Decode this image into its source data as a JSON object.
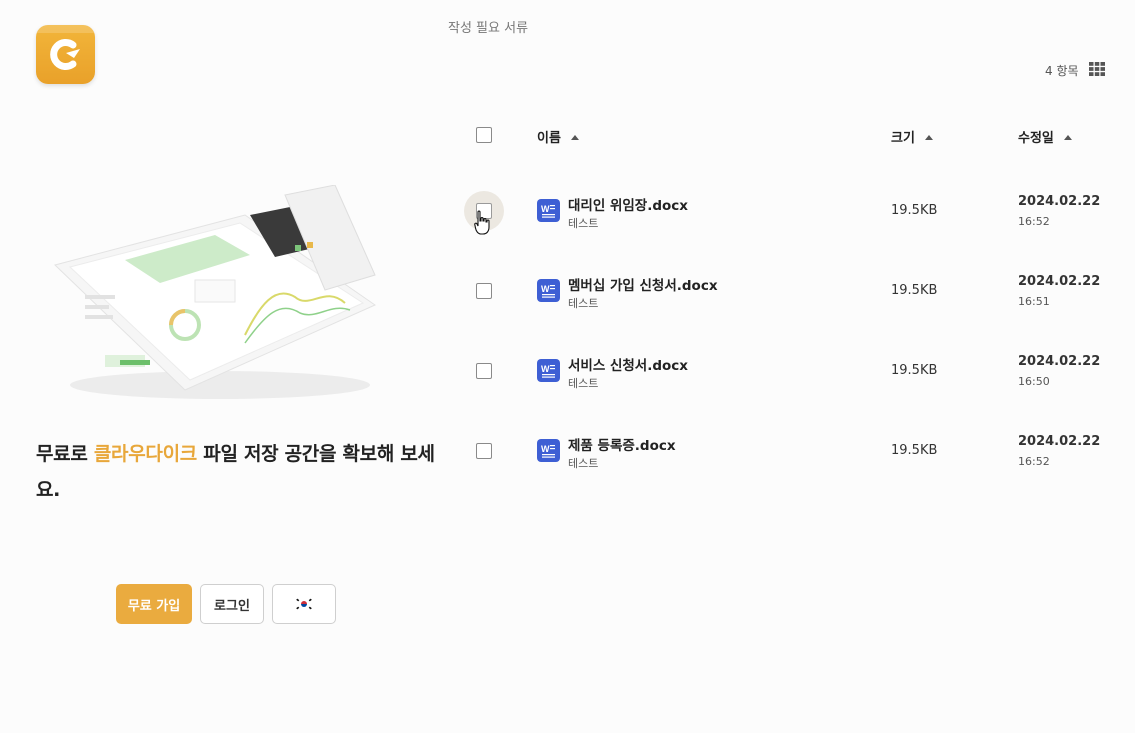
{
  "app": {
    "logo_icon": "cloudike-logo-icon",
    "brand_color": "#eaab3f"
  },
  "promo": {
    "tagline_prefix": "무료로 ",
    "tagline_brand": "클라우다이크",
    "tagline_suffix": " 파일 저장 공간을 확보해 보세요.",
    "signup_label": "무료 가입",
    "login_label": "로그인",
    "language_icon": "korea-flag-icon"
  },
  "folder": {
    "title": "작성 필요 서류",
    "item_count": "4 항목",
    "view_icon": "grid-view-icon"
  },
  "table": {
    "columns": {
      "name": "이름",
      "size": "크기",
      "modified": "수정일"
    },
    "rows": [
      {
        "name": "대리인 위임장.docx",
        "owner": "테스트",
        "size": "19.5KB",
        "date": "2024.02.22",
        "time": "16:52",
        "icon": "word-doc-icon"
      },
      {
        "name": "멤버십 가입 신청서.docx",
        "owner": "테스트",
        "size": "19.5KB",
        "date": "2024.02.22",
        "time": "16:51",
        "icon": "word-doc-icon"
      },
      {
        "name": "서비스 신청서.docx",
        "owner": "테스트",
        "size": "19.5KB",
        "date": "2024.02.22",
        "time": "16:50",
        "icon": "word-doc-icon"
      },
      {
        "name": "제품 등록증.docx",
        "owner": "테스트",
        "size": "19.5KB",
        "date": "2024.02.22",
        "time": "16:52",
        "icon": "word-doc-icon"
      }
    ]
  }
}
